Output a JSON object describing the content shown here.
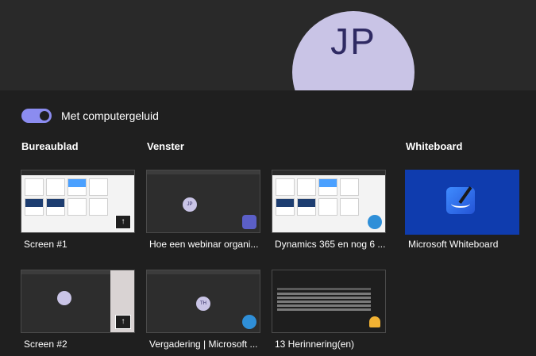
{
  "stage": {
    "avatar_initials": "JP"
  },
  "audio_toggle": {
    "label": "Met computergeluid",
    "enabled": true
  },
  "sections": {
    "desktop": "Bureaublad",
    "window": "Venster",
    "whiteboard": "Whiteboard"
  },
  "desktop_tiles": [
    {
      "label": "Screen #1"
    },
    {
      "label": "Screen #2"
    }
  ],
  "window_tiles": [
    {
      "label": "Hoe een webinar organi...",
      "avatar": "JP"
    },
    {
      "label": "Dynamics 365 en nog 6 ..."
    },
    {
      "label": "Vergadering | Microsoft ...",
      "avatar": "TH"
    },
    {
      "label": "13 Herinnering(en)"
    }
  ],
  "whiteboard_tile": {
    "label": "Microsoft Whiteboard"
  },
  "colors": {
    "accent": "#8b8cf0",
    "whiteboard_bg": "#0f3cae",
    "avatar_bg": "#c9c4e6"
  }
}
